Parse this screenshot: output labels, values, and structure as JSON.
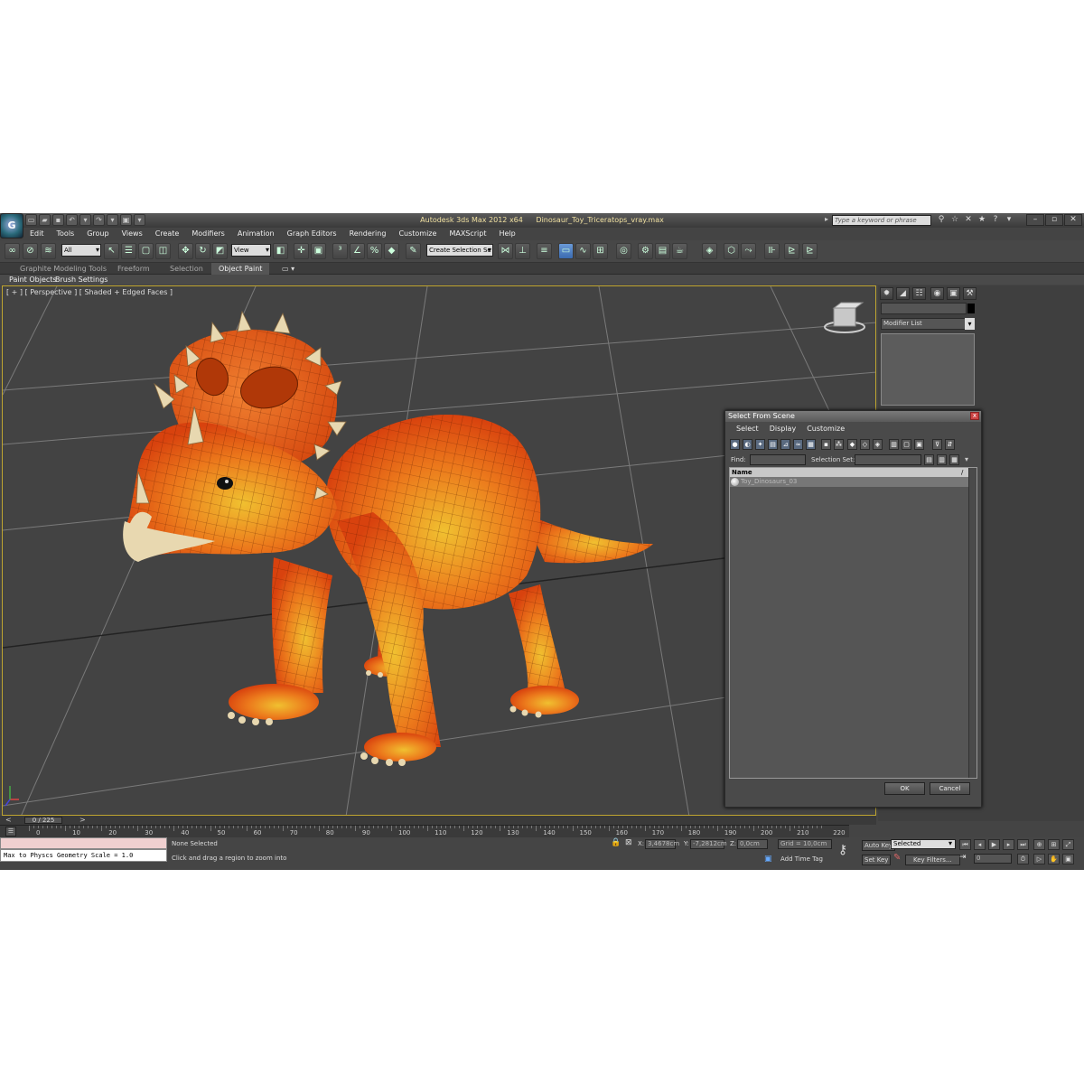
{
  "title": {
    "app": "Autodesk 3ds Max  2012 x64",
    "file": "Dinosaur_Toy_Triceratops_vray.max",
    "search_placeholder": "Type a keyword or phrase"
  },
  "menubar": [
    "Edit",
    "Tools",
    "Group",
    "Views",
    "Create",
    "Modifiers",
    "Animation",
    "Graph Editors",
    "Rendering",
    "Customize",
    "MAXScript",
    "Help"
  ],
  "toolbar": {
    "selection_filter": "All",
    "reference_coord": "View",
    "selection_set": "Create Selection Se"
  },
  "ribbon": {
    "tabs": [
      "Graphite Modeling Tools",
      "Freeform",
      "Selection",
      "Object Paint"
    ],
    "active_tab": "Object Paint",
    "panels": [
      "Paint Objects",
      "Brush Settings"
    ]
  },
  "viewport": {
    "label": "[ + ] [ Perspective ] [ Shaded + Edged Faces ]",
    "border_color": "#bfa530"
  },
  "command_panel": {
    "modifier_list": "Modifier List"
  },
  "select_dialog": {
    "title": "Select From Scene",
    "menu": [
      "Select",
      "Display",
      "Customize"
    ],
    "find_label": "Find:",
    "selection_set_label": "Selection Set:",
    "column_name": "Name",
    "column_sort": "/",
    "items": [
      "Toy_Dinosaurs_03"
    ],
    "ok": "OK",
    "cancel": "Cancel"
  },
  "timeline": {
    "slider": "0 / 225",
    "ticks": [
      "0",
      "10",
      "20",
      "30",
      "40",
      "50",
      "60",
      "70",
      "80",
      "90",
      "100",
      "110",
      "120",
      "130",
      "140",
      "150",
      "160",
      "170",
      "180",
      "190",
      "200",
      "210",
      "220"
    ]
  },
  "listener": {
    "output": "Max to Physcs Geometry Scale = 1.0"
  },
  "status": {
    "selection": "None Selected",
    "prompt": "Click and drag a region to zoom into",
    "x_label": "X:",
    "x": "3,4678cm",
    "y_label": "Y:",
    "y": "-7,2812cm",
    "z_label": "Z:",
    "z": "0,0cm",
    "grid": "Grid = 10,0cm",
    "add_time_tag": "Add Time Tag",
    "auto_key": "Auto Key",
    "set_key": "Set Key",
    "key_mode": "Selected",
    "key_filters": "Key Filters...",
    "frame": "0"
  },
  "colors": {
    "dino_body": "#e8611a",
    "dino_belly": "#f0b020",
    "horn": "#e8d8b0"
  }
}
